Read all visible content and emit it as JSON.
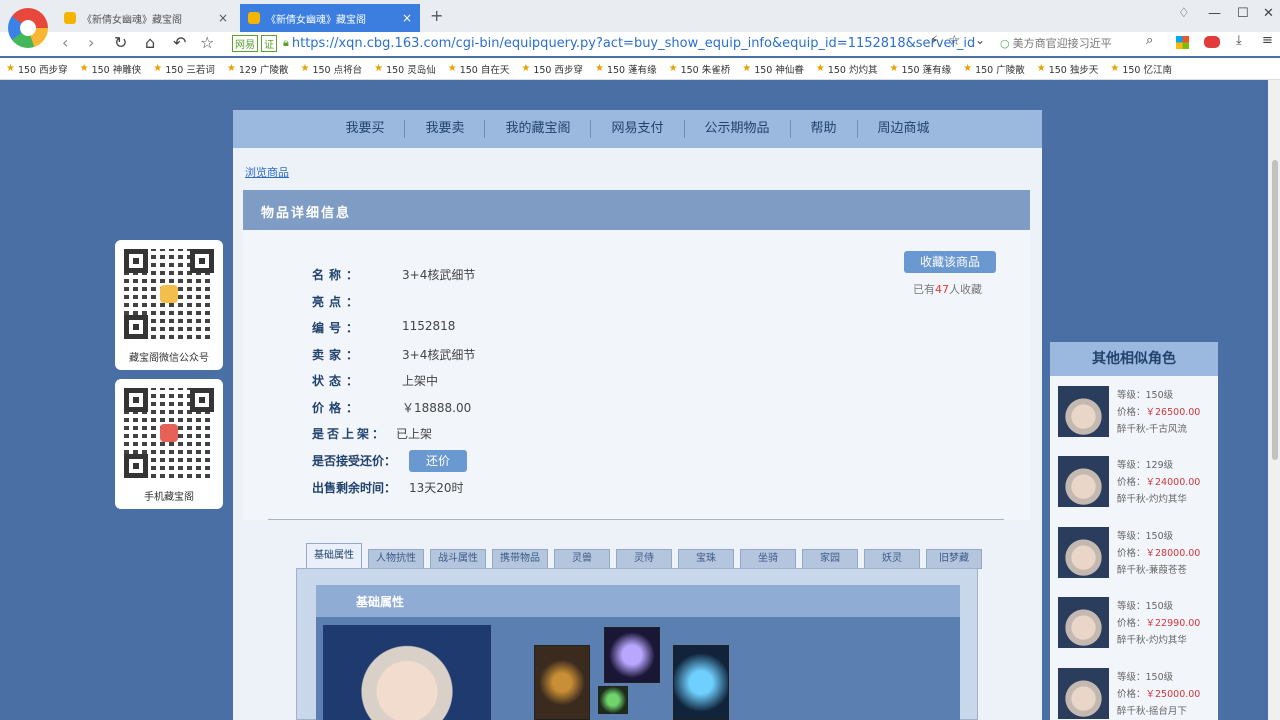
{
  "browser": {
    "tabs": [
      {
        "title": "《新倩女幽魂》藏宝阁",
        "active": false
      },
      {
        "title": "《新倩女幽魂》藏宝阁",
        "active": true
      }
    ],
    "new_tab": "+",
    "close": "×",
    "url": {
      "badge": "网易",
      "cert": "证",
      "text": "https://xqn.cbg.163.com/cgi-bin/equipquery.py?act=buy_show_equip_info&equip_id=1152818&server_id"
    },
    "search_text": "美方商官迎接习近平",
    "bookmarks": [
      "150 西步穿",
      "150 神雕侠",
      "150 三若词",
      "129 广陵散",
      "150 点将台",
      "150 灵岛仙",
      "150 自在天",
      "150 西步穿",
      "150 蓬有缘",
      "150 朱雀桥",
      "150 神仙眷",
      "150 灼灼其",
      "150 蓬有缘",
      "150 广陵散",
      "150 独步天",
      "150 忆江南"
    ]
  },
  "menu": [
    "我要买",
    "我要卖",
    "我的藏宝阁",
    "网易支付",
    "公示期物品",
    "帮助",
    "周边商城"
  ],
  "breadcrumb": "浏览商品",
  "section_title": "物品详细信息",
  "details": {
    "name": {
      "label": "名称：",
      "value": "3+4核武细节"
    },
    "highlight": {
      "label": "亮点：",
      "value": ""
    },
    "id": {
      "label": "编号：",
      "value": "1152818"
    },
    "seller": {
      "label": "卖家：",
      "value": "3+4核武细节"
    },
    "status": {
      "label": "状态：",
      "value": "上架中"
    },
    "price": {
      "label": "价格：",
      "value": "￥18888.00"
    },
    "listed": {
      "label": "是否上架：",
      "value": "已上架"
    },
    "counter_offer": {
      "label": "是否接受还价：",
      "button": "还价"
    },
    "time_left": {
      "label": "出售剩余时间：",
      "value": "13天20时"
    }
  },
  "favorite": {
    "button": "收藏该商品",
    "prefix": "已有",
    "count": "47",
    "suffix": "人收藏"
  },
  "detail_tabs": [
    "基础属性",
    "人物抗性",
    "战斗属性",
    "携带物品",
    "灵兽",
    "灵侍",
    "宝珠",
    "坐骑",
    "家园",
    "妖灵",
    "旧梦藏"
  ],
  "tab_title": "基础属性",
  "qr": [
    {
      "label": "藏宝阁微信公众号"
    },
    {
      "label": "手机藏宝阁"
    }
  ],
  "similar": {
    "title": "其他相似角色",
    "items": [
      {
        "level": "等级：150级",
        "price_label": "价格：",
        "price": "￥26500.00",
        "name": "醉千秋-千古风流"
      },
      {
        "level": "等级：129级",
        "price_label": "价格：",
        "price": "￥24000.00",
        "name": "醉千秋-灼灼其华"
      },
      {
        "level": "等级：150级",
        "price_label": "价格：",
        "price": "￥28000.00",
        "name": "醉千秋-蒹葭苍苍"
      },
      {
        "level": "等级：150级",
        "price_label": "价格：",
        "price": "￥22990.00",
        "name": "醉千秋-灼灼其华"
      },
      {
        "level": "等级：150级",
        "price_label": "价格：",
        "price": "￥25000.00",
        "name": "醉千秋-摇台月下"
      }
    ]
  }
}
